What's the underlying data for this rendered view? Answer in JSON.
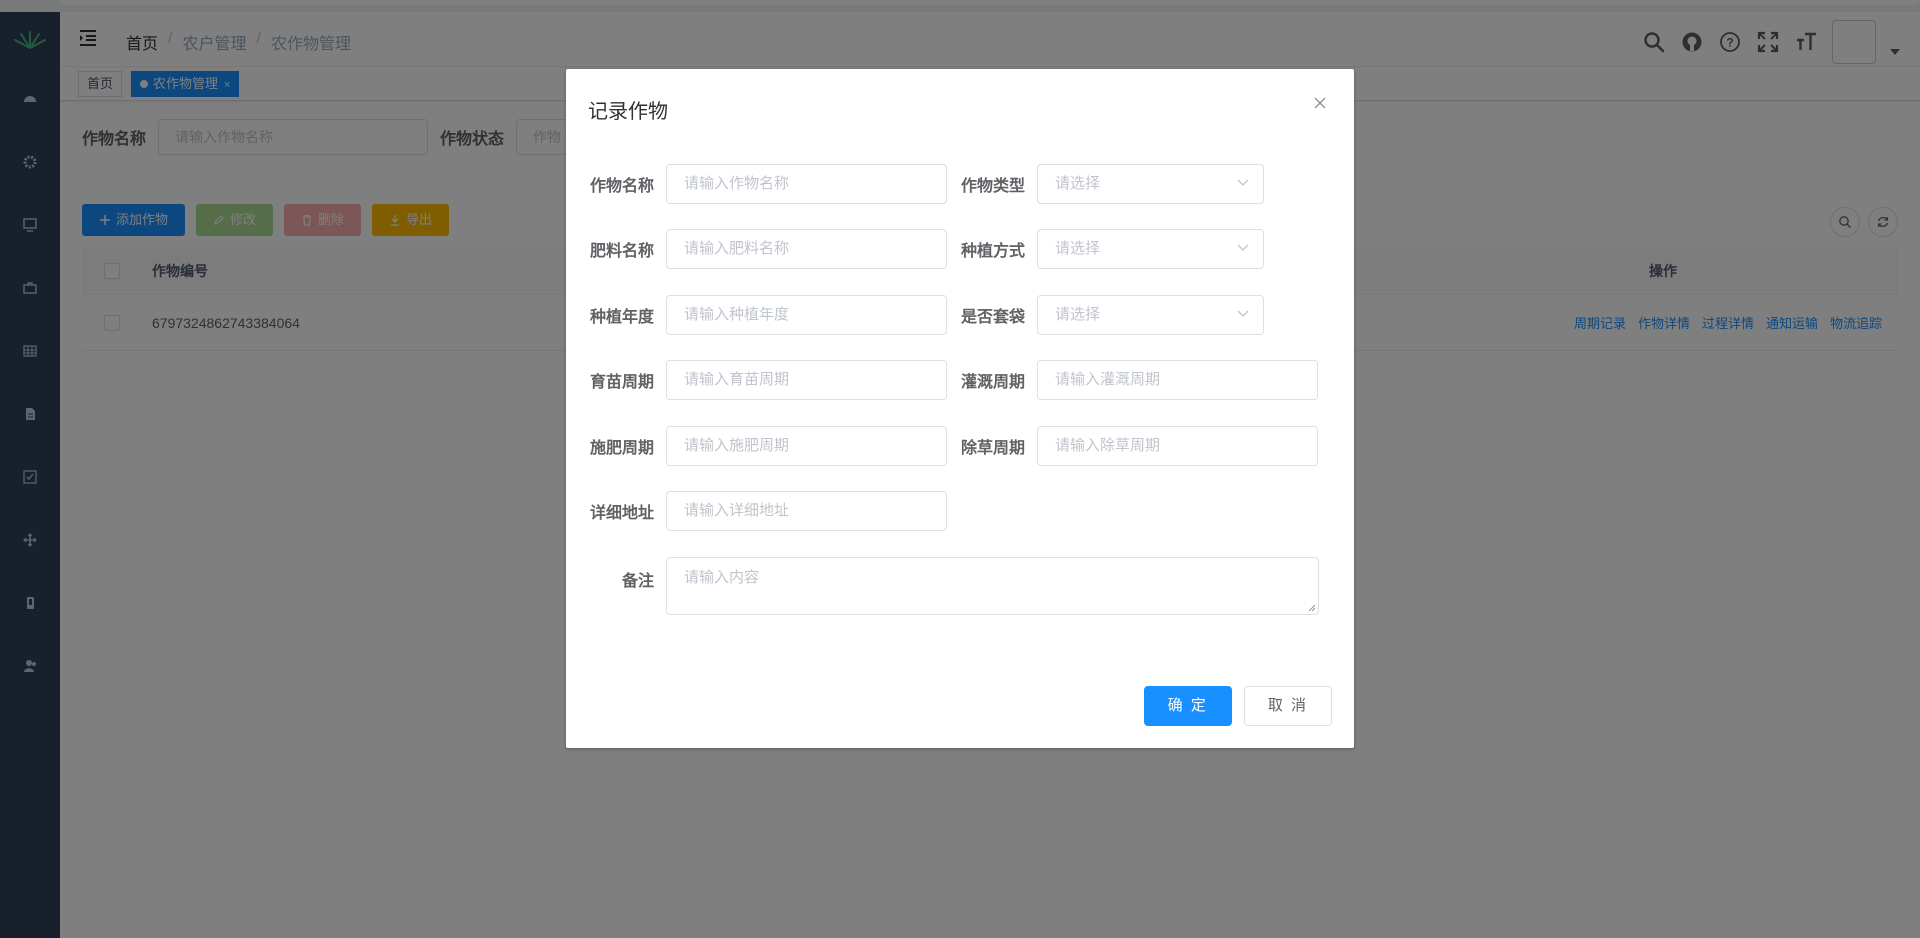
{
  "navbar": {
    "breadcrumb": [
      "首页",
      "农户管理",
      "农作物管理"
    ],
    "breadcrumb_sep": "/"
  },
  "tags": {
    "home": "首页",
    "active": "农作物管理",
    "close": "×"
  },
  "search": {
    "crop_name_label": "作物名称",
    "crop_name_placeholder": "请输入作物名称",
    "crop_status_label": "作物状态",
    "crop_status_placeholder": "作物"
  },
  "toolbar": {
    "add": "添加作物",
    "edit": "修改",
    "delete": "删除",
    "export": "导出"
  },
  "table": {
    "headers": {
      "id": "作物编号",
      "ops": "操作"
    },
    "rows": [
      {
        "id": "6797324862743384064",
        "ops": [
          "周期记录",
          "作物详情",
          "过程详情",
          "通知运输",
          "物流追踪"
        ]
      }
    ]
  },
  "dialog": {
    "title": "记录作物",
    "fields": {
      "crop_name": {
        "label": "作物名称",
        "placeholder": "请输入作物名称"
      },
      "crop_type": {
        "label": "作物类型",
        "placeholder": "请选择"
      },
      "fertilizer_name": {
        "label": "肥料名称",
        "placeholder": "请输入肥料名称"
      },
      "planting_method": {
        "label": "种植方式",
        "placeholder": "请选择"
      },
      "planting_year": {
        "label": "种植年度",
        "placeholder": "请输入种植年度"
      },
      "bagged": {
        "label": "是否套袋",
        "placeholder": "请选择"
      },
      "seedling_cycle": {
        "label": "育苗周期",
        "placeholder": "请输入育苗周期"
      },
      "irrigation_cycle": {
        "label": "灌溉周期",
        "placeholder": "请输入灌溉周期"
      },
      "fertilize_cycle": {
        "label": "施肥周期",
        "placeholder": "请输入施肥周期"
      },
      "weeding_cycle": {
        "label": "除草周期",
        "placeholder": "请输入除草周期"
      },
      "address": {
        "label": "详细地址",
        "placeholder": "请输入详细地址"
      },
      "remark": {
        "label": "备注",
        "placeholder": "请输入内容"
      }
    },
    "ok": "确 定",
    "cancel": "取 消"
  },
  "colors": {
    "sidebar": "#304156",
    "primary": "#1890ff",
    "overlay": "rgba(0,0,0,0.5)"
  }
}
